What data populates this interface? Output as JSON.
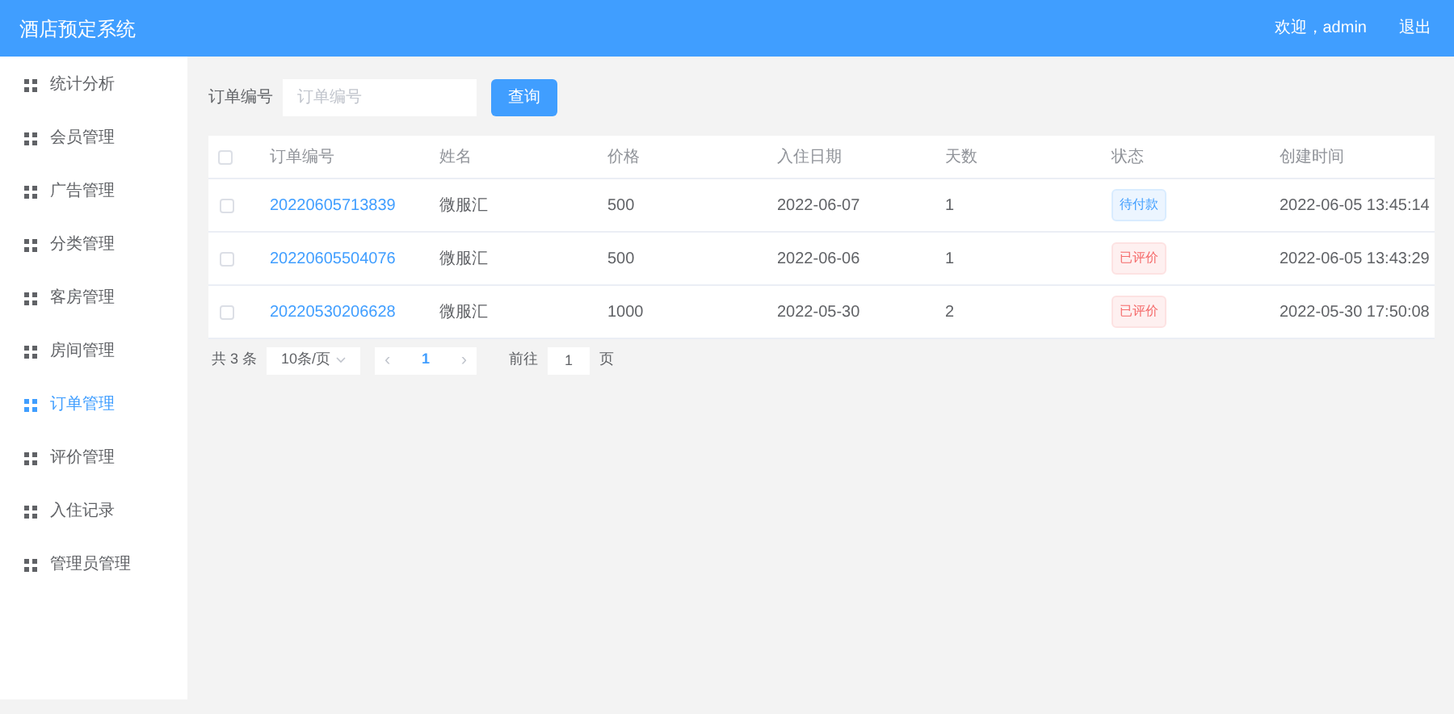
{
  "header": {
    "title": "酒店预定系统",
    "welcome": "欢迎，admin",
    "logout": "退出"
  },
  "sidebar": {
    "items": [
      {
        "label": "统计分析",
        "selected": false
      },
      {
        "label": "会员管理",
        "selected": false
      },
      {
        "label": "广告管理",
        "selected": false
      },
      {
        "label": "分类管理",
        "selected": false
      },
      {
        "label": "客房管理",
        "selected": false
      },
      {
        "label": "房间管理",
        "selected": false
      },
      {
        "label": "订单管理",
        "selected": true
      },
      {
        "label": "评价管理",
        "selected": false
      },
      {
        "label": "入住记录",
        "selected": false
      },
      {
        "label": "管理员管理",
        "selected": false
      }
    ]
  },
  "search": {
    "label": "订单编号",
    "placeholder": "订单编号",
    "button": "查询"
  },
  "table": {
    "select_all_checked": false,
    "columns": [
      "订单编号",
      "姓名",
      "价格",
      "入住日期",
      "天数",
      "状态",
      "创建时间"
    ],
    "rows": [
      {
        "checked": false,
        "order_no": "20220605713839",
        "name": "微服汇",
        "price": "500",
        "checkin": "2022-06-07",
        "days": "1",
        "status": {
          "text": "待付款",
          "kind": "pending"
        },
        "created": "2022-06-05 13:45:14"
      },
      {
        "checked": false,
        "order_no": "20220605504076",
        "name": "微服汇",
        "price": "500",
        "checkin": "2022-06-06",
        "days": "1",
        "status": {
          "text": "已评价",
          "kind": "reviewed"
        },
        "created": "2022-06-05 13:43:29"
      },
      {
        "checked": false,
        "order_no": "20220530206628",
        "name": "微服汇",
        "price": "1000",
        "checkin": "2022-05-30",
        "days": "2",
        "status": {
          "text": "已评价",
          "kind": "reviewed"
        },
        "created": "2022-05-30 17:50:08"
      }
    ]
  },
  "pagination": {
    "total": "共 3 条",
    "page_size": "10条/页",
    "prev": "‹",
    "current_page": "1",
    "next": "›",
    "goto_label": "前往",
    "goto_value": "1",
    "page_suffix": "页"
  }
}
